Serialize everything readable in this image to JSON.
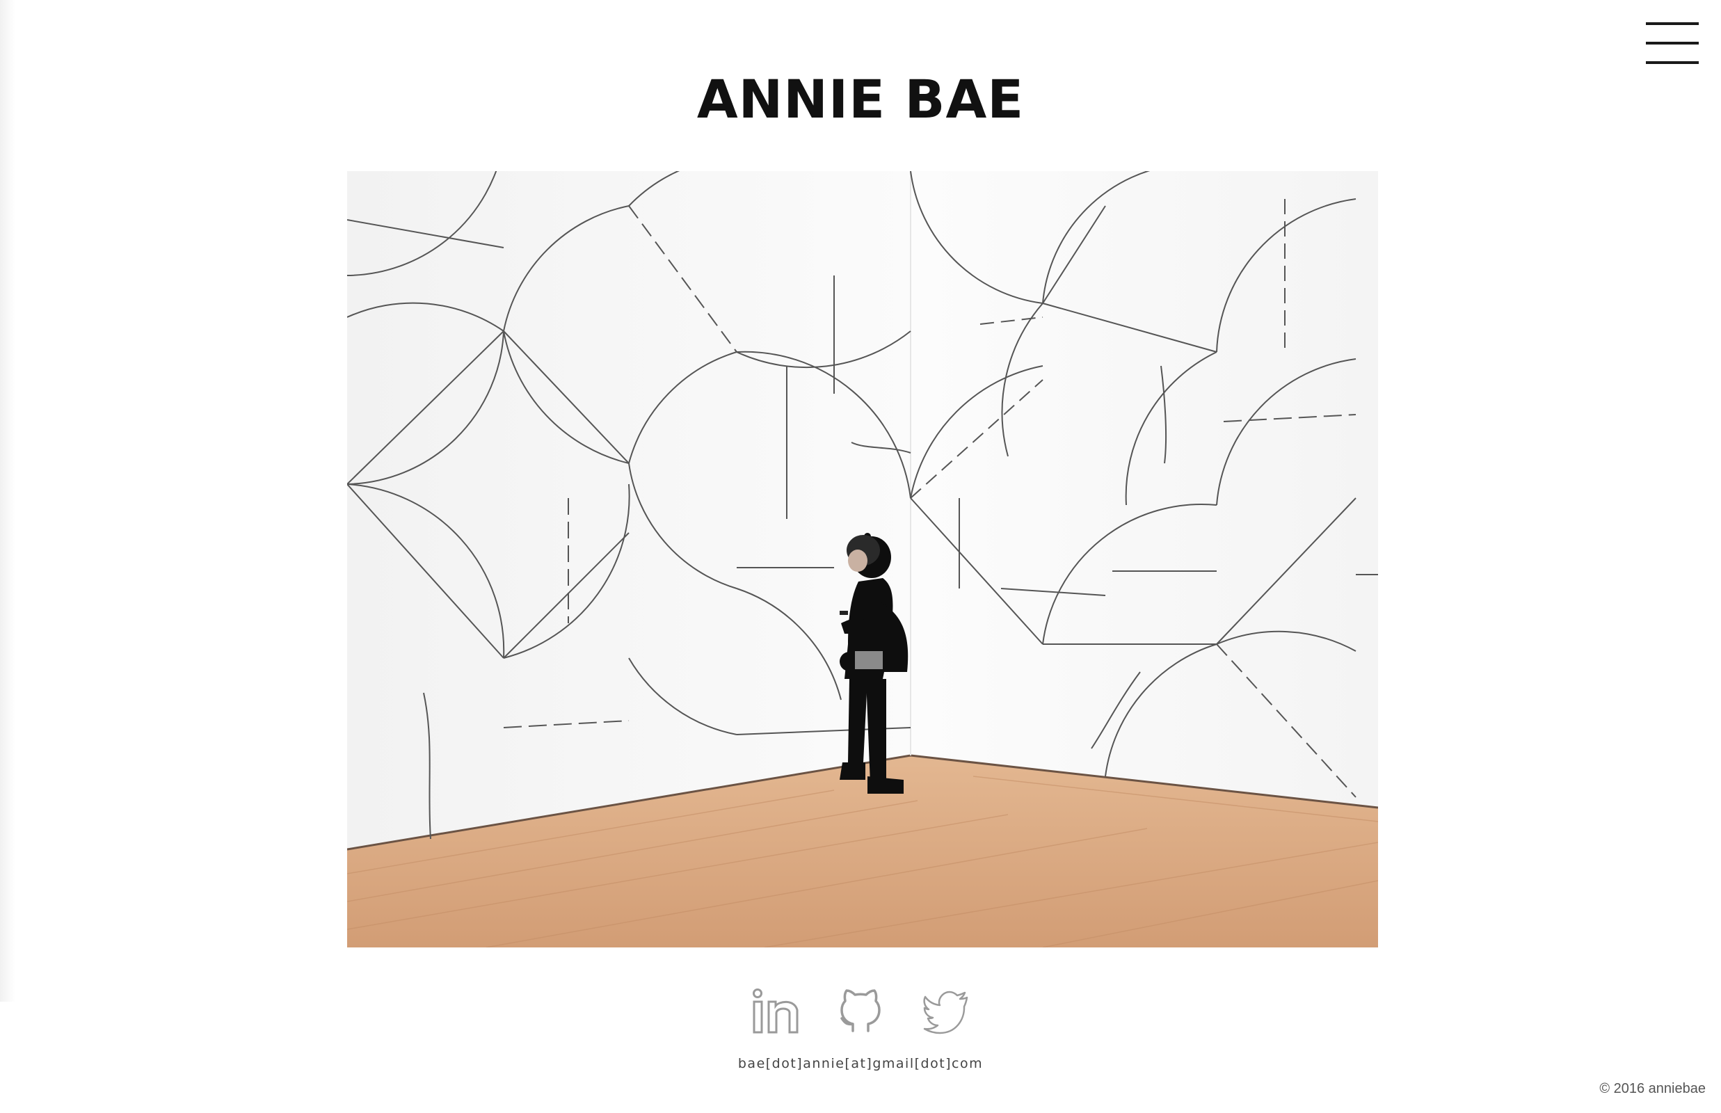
{
  "site": {
    "title": "ANNIE BAE"
  },
  "menu": {
    "icon": "hamburger-menu-icon"
  },
  "hero": {
    "icon": "photo-of-person-in-gallery"
  },
  "social": [
    {
      "name": "linkedin",
      "icon": "linkedin-icon"
    },
    {
      "name": "github",
      "icon": "github-icon"
    },
    {
      "name": "twitter",
      "icon": "twitter-icon"
    }
  ],
  "contact": {
    "email": "bae[dot]annie[at]gmail[dot]com"
  },
  "footer": {
    "copyright": "© 2016 anniebae"
  },
  "colors": {
    "text": "#111111",
    "icon_gray": "#9a9a9a",
    "floor": "#d9a57c",
    "wall": "#f7f7f7"
  }
}
